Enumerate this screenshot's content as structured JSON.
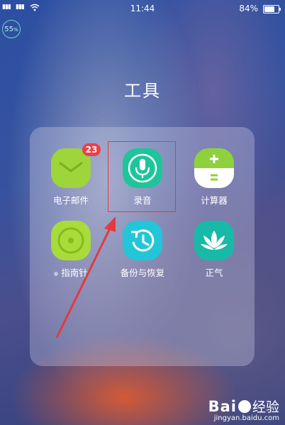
{
  "status_bar": {
    "signal1": "ฅ۲ıl",
    "signal2": "ฅ۲ıl",
    "time": "11:44",
    "battery": "84%",
    "battery_level": 0.84,
    "icons": [
      "signal-icon",
      "signal-icon",
      "wifi-icon",
      "battery-icon"
    ]
  },
  "memory_badge": {
    "value": "55",
    "unit": "%"
  },
  "folder": {
    "title": "工具",
    "apps": [
      {
        "label": "电子邮件",
        "icon": "email-icon",
        "badge": "23",
        "color": "#9ed53a"
      },
      {
        "label": "录音",
        "icon": "microphone-icon",
        "color": "#1fc59a"
      },
      {
        "label": "计算器",
        "icon": "calculator-icon",
        "color": "#8fd13d"
      },
      {
        "label": "指南针",
        "icon": "compass-icon",
        "color": "#a8dc3a"
      },
      {
        "label": "备份与恢复",
        "icon": "backup-restore-icon",
        "color": "#22c6d8"
      },
      {
        "label": "正气",
        "icon": "lotus-icon",
        "color": "#19b9a8"
      }
    ]
  },
  "annotation": {
    "highlight_color": "#e23a3f"
  },
  "watermark": {
    "brand": "Bai",
    "brand2": "经验",
    "url": "jingyan.baidu.com"
  }
}
